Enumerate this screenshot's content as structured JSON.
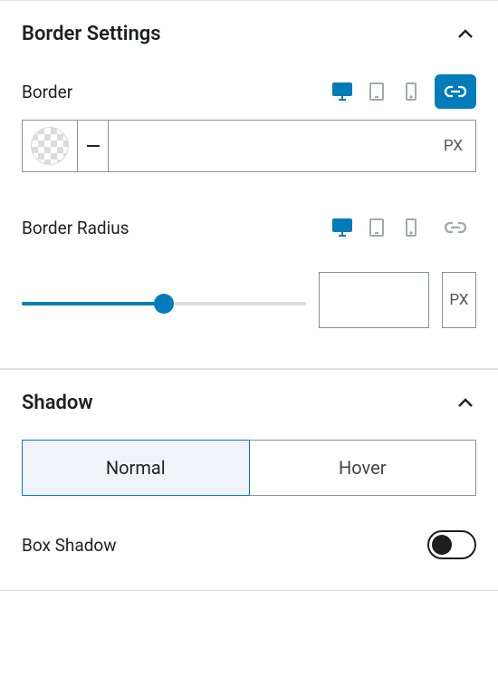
{
  "sections": {
    "border": {
      "title": "Border Settings"
    },
    "shadow": {
      "title": "Shadow"
    }
  },
  "border": {
    "label": "Border",
    "unit": "PX",
    "value": "",
    "devices": {
      "active": "desktop"
    },
    "linked": true
  },
  "radius": {
    "label": "Border Radius",
    "unit": "PX",
    "value": "",
    "slider": 50,
    "devices": {
      "active": "desktop"
    },
    "linked": false
  },
  "shadow": {
    "tabs": {
      "normal": "Normal",
      "hover": "Hover",
      "active": "normal"
    },
    "box_shadow": {
      "label": "Box Shadow",
      "on": false
    }
  }
}
